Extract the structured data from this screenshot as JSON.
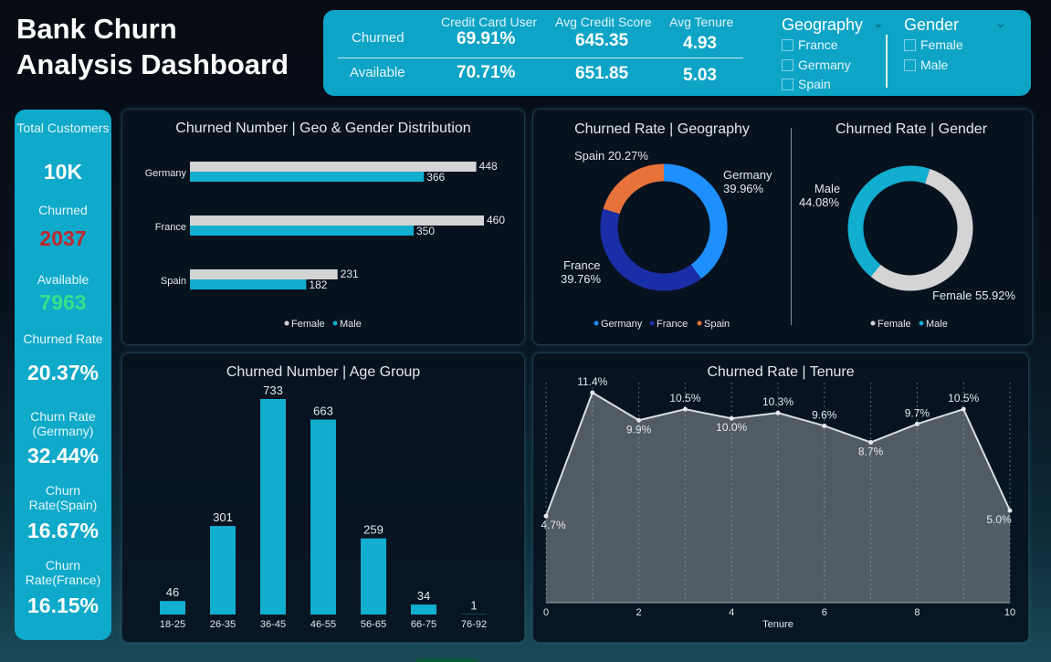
{
  "header": {
    "title_line1": "Bank Churn",
    "title_line2": "Analysis Dashboard"
  },
  "summary": {
    "row_labels": [
      "Churned",
      "Available"
    ],
    "columns": [
      "Credit Card User",
      "Avg Credit Score",
      "Avg Tenure"
    ],
    "churned": [
      "69.91%",
      "645.35",
      "4.93"
    ],
    "available": [
      "70.71%",
      "651.85",
      "5.03"
    ]
  },
  "slicers": {
    "geography": {
      "title": "Geography",
      "options": [
        "France",
        "Germany",
        "Spain"
      ]
    },
    "gender": {
      "title": "Gender",
      "options": [
        "Female",
        "Male"
      ]
    }
  },
  "kpis": {
    "total_label": "Total Customers",
    "total_value": "10K",
    "churned_label": "Churned",
    "churned_value": "2037",
    "available_label": "Available",
    "available_value": "7963",
    "rate_label": "Churned Rate",
    "rate_value": "20.37%",
    "germany_label": "Churn Rate (Germany)",
    "germany_value": "32.44%",
    "spain_label": "Churn Rate(Spain)",
    "spain_value": "16.67%",
    "france_label": "Churn Rate(France)",
    "france_value": "16.15%"
  },
  "colors": {
    "accent": "#0fa9c9",
    "female": "#d4d4d4",
    "male": "#12aecf",
    "germany": "#1e8fff",
    "france": "#1a2ea8",
    "spain": "#e8733a",
    "churned_red": "#c0282e",
    "available_green": "#35e08a"
  },
  "chart_data": [
    {
      "type": "bar",
      "title": "Churned Number | Geo & Gender Distribution",
      "categories": [
        "Germany",
        "France",
        "Spain"
      ],
      "series": [
        {
          "name": "Female",
          "values": [
            448,
            460,
            231
          ]
        },
        {
          "name": "Male",
          "values": [
            366,
            350,
            182
          ]
        }
      ],
      "legend": "bottom",
      "legend_labels": [
        "Female",
        "Male"
      ]
    },
    {
      "type": "pie",
      "title": "Churned Rate | Geography",
      "categories": [
        "Germany",
        "France",
        "Spain"
      ],
      "values": [
        39.96,
        39.76,
        20.27
      ],
      "labels": [
        "Germany 39.96%",
        "France 39.76%",
        "Spain 20.27%"
      ],
      "legend": "bottom"
    },
    {
      "type": "pie",
      "title": "Churned Rate | Gender",
      "categories": [
        "Male",
        "Female"
      ],
      "values": [
        44.08,
        55.92
      ],
      "labels": [
        "Male 44.08%",
        "Female 55.92%"
      ],
      "legend": "bottom"
    },
    {
      "type": "bar",
      "title": "Churned Number | Age Group",
      "categories": [
        "18-25",
        "26-35",
        "36-45",
        "46-55",
        "56-65",
        "66-75",
        "76-92"
      ],
      "values": [
        46,
        301,
        733,
        663,
        259,
        34,
        1
      ]
    },
    {
      "type": "area",
      "title": "Churned Rate | Tenure",
      "xlabel": "Tenure",
      "x": [
        0,
        1,
        2,
        3,
        4,
        5,
        6,
        7,
        8,
        9,
        10
      ],
      "values": [
        4.7,
        11.4,
        9.9,
        10.5,
        10.0,
        10.3,
        9.6,
        8.7,
        9.7,
        10.5,
        5.0
      ],
      "labels": [
        "4.7%",
        "11.4%",
        "9.9%",
        "10.5%",
        "10.0%",
        "10.3%",
        "9.6%",
        "8.7%",
        "9.7%",
        "10.5%",
        "5.0%"
      ],
      "xticks": [
        "0",
        "2",
        "4",
        "6",
        "8",
        "10"
      ]
    }
  ]
}
